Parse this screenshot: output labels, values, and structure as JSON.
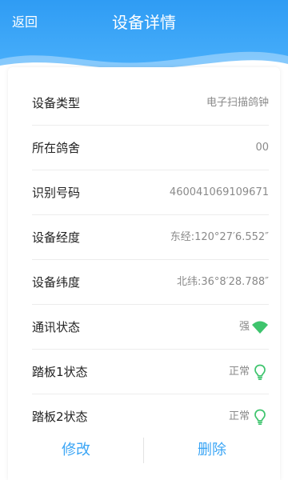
{
  "header": {
    "back_label": "返回",
    "title": "设备详情",
    "color": "#3aa5f5"
  },
  "details": {
    "type": {
      "label": "设备类型",
      "value": "电子扫描鸽钟"
    },
    "loft": {
      "label": "所在鸽舍",
      "value": "00"
    },
    "id_code": {
      "label": "识别号码",
      "value": "460041069109671"
    },
    "longitude": {
      "label": "设备经度",
      "value": "东经:120°27′6.552″"
    },
    "latitude": {
      "label": "设备纬度",
      "value": "北纬:36°8′28.788″"
    },
    "signal": {
      "label": "通讯状态",
      "value": "强",
      "icon": "wifi-signal-icon",
      "icon_color": "#3ec46d"
    },
    "pedal1": {
      "label": "踏板1状态",
      "value": "正常",
      "icon": "lightbulb-icon",
      "icon_color": "#3ec46d"
    },
    "pedal2": {
      "label": "踏板2状态",
      "value": "正常",
      "icon": "lightbulb-icon",
      "icon_color": "#3ec46d"
    }
  },
  "actions": {
    "edit_label": "修改",
    "delete_label": "删除",
    "color": "#3aa5f5"
  }
}
